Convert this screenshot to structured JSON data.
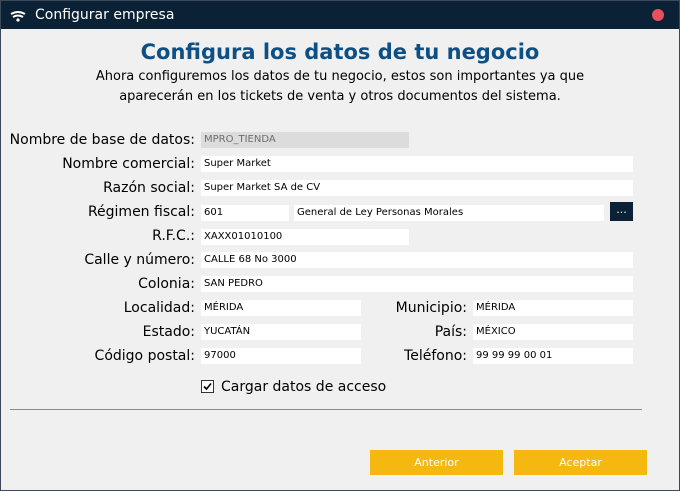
{
  "window": {
    "title": "Configurar empresa"
  },
  "header": {
    "title": "Configura los datos de tu negocio",
    "subtitle_line1": "Ahora configuremos los datos de tu negocio, estos son importantes ya que",
    "subtitle_line2": "aparecerán en los tickets de venta y otros documentos del sistema."
  },
  "form": {
    "db_name": {
      "label": "Nombre de base de datos:",
      "value": "MPRO_TIENDA"
    },
    "trade_name": {
      "label": "Nombre comercial:",
      "value": "Super Market"
    },
    "legal_name": {
      "label": "Razón social:",
      "value": "Super Market SA de CV"
    },
    "tax_regime": {
      "label": "Régimen fiscal:",
      "code": "601",
      "description": "General de Ley Personas Morales",
      "button_label": "..."
    },
    "rfc": {
      "label": "R.F.C.:",
      "value": "XAXX01010100"
    },
    "street": {
      "label": "Calle y número:",
      "value": "CALLE 68 No 3000"
    },
    "colony": {
      "label": "Colonia:",
      "value": "SAN PEDRO"
    },
    "locality": {
      "label": "Localidad:",
      "value": "MÉRIDA"
    },
    "municipality": {
      "label": "Municipio:",
      "value": "MÉRIDA"
    },
    "state": {
      "label": "Estado:",
      "value": "YUCATÁN"
    },
    "country": {
      "label": "País:",
      "value": "MÉXICO"
    },
    "postal_code": {
      "label": "Código postal:",
      "value": "97000"
    },
    "phone": {
      "label": "Teléfono:",
      "value": "99 99 99 00 01"
    },
    "load_access": {
      "label": "Cargar datos de acceso",
      "checked": true
    }
  },
  "footer": {
    "back_label": "Anterior",
    "accept_label": "Aceptar"
  },
  "colors": {
    "titlebar": "#0b2236",
    "heading": "#0e4f84",
    "button": "#f5b811",
    "close": "#e8505b"
  }
}
